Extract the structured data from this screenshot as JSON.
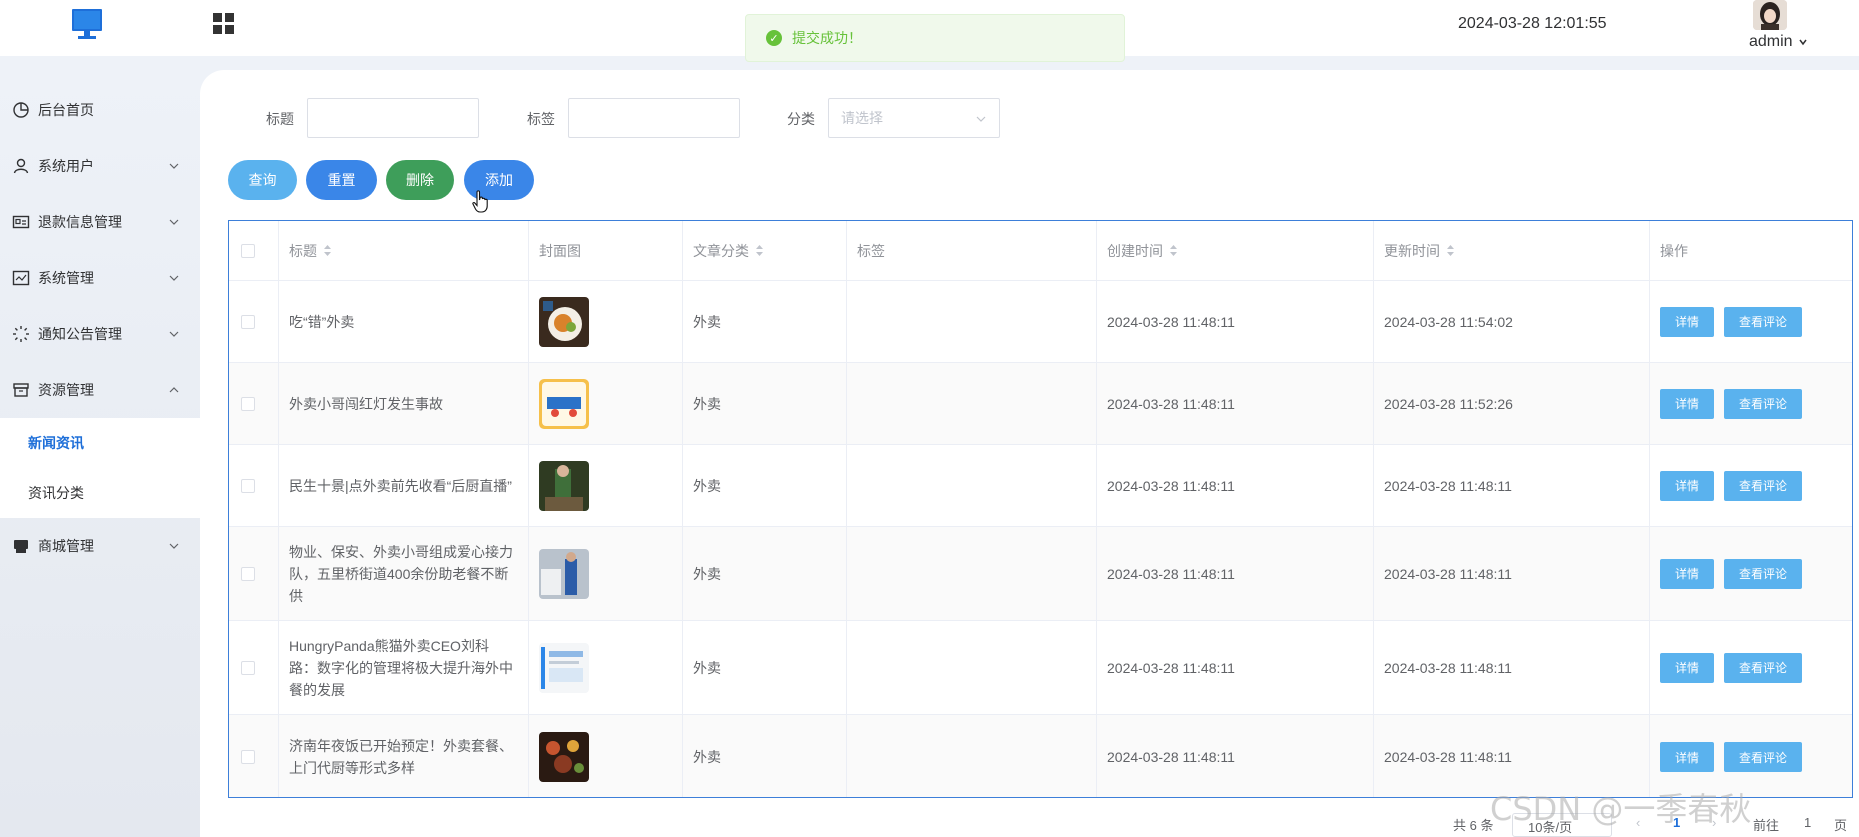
{
  "header": {
    "datetime": "2024-03-28 12:01:55",
    "username": "admin",
    "toast": "提交成功！"
  },
  "sidebar": {
    "items": [
      {
        "label": "后台首页",
        "icon": "pie-chart-icon"
      },
      {
        "label": "系统用户",
        "icon": "user-icon"
      },
      {
        "label": "退款信息管理",
        "icon": "id-card-icon"
      },
      {
        "label": "系统管理",
        "icon": "chart-box-icon"
      },
      {
        "label": "通知公告管理",
        "icon": "loading-icon"
      },
      {
        "label": "资源管理",
        "icon": "inbox-icon"
      },
      {
        "label": "商城管理",
        "icon": "printer-icon"
      }
    ],
    "subitems": [
      {
        "label": "新闻资讯",
        "active": true
      },
      {
        "label": "资讯分类",
        "active": false
      }
    ]
  },
  "filters": {
    "title_label": "标题",
    "tag_label": "标签",
    "category_label": "分类",
    "category_placeholder": "请选择",
    "title_value": "",
    "tag_value": ""
  },
  "buttons": {
    "query": "查询",
    "reset": "重置",
    "delete": "删除",
    "add": "添加"
  },
  "table": {
    "headers": {
      "title": "标题",
      "cover": "封面图",
      "category": "文章分类",
      "tags": "标签",
      "created": "创建时间",
      "updated": "更新时间",
      "actions": "操作"
    },
    "rows": [
      {
        "title": "吃“错”外卖",
        "category": "外卖",
        "tags": "",
        "created": "2024-03-28 11:48:11",
        "updated": "2024-03-28 11:54:02"
      },
      {
        "title": "外卖小哥闯红灯发生事故",
        "category": "外卖",
        "tags": "",
        "created": "2024-03-28 11:48:11",
        "updated": "2024-03-28 11:52:26"
      },
      {
        "title": "民生十景|点外卖前先收看“后厨直播”",
        "category": "外卖",
        "tags": "",
        "created": "2024-03-28 11:48:11",
        "updated": "2024-03-28 11:48:11"
      },
      {
        "title": "物业、保安、外卖小哥组成爱心接力队，五里桥街道400余份助老餐不断供",
        "category": "外卖",
        "tags": "",
        "created": "2024-03-28 11:48:11",
        "updated": "2024-03-28 11:48:11"
      },
      {
        "title": "HungryPanda熊猫外卖CEO刘科路：数字化的管理将极大提升海外中餐的发展",
        "category": "外卖",
        "tags": "",
        "created": "2024-03-28 11:48:11",
        "updated": "2024-03-28 11:48:11"
      },
      {
        "title": "济南年夜饭已开始预定！外卖套餐、上门代厨等形式多样",
        "category": "外卖",
        "tags": "",
        "created": "2024-03-28 11:48:11",
        "updated": "2024-03-28 11:48:11"
      }
    ],
    "detail_label": "详情",
    "comment_label": "查看评论"
  },
  "pagination": {
    "total": "共 6 条",
    "page_size": "10条/页",
    "current": "1",
    "goto_label": "前往",
    "goto_value": "1",
    "page_suffix": "页"
  },
  "watermark": "CSDN @一季春秋",
  "colors": {
    "query": "#5ab2ee",
    "reset": "#3a86e8",
    "delete": "#3e9e5a",
    "add": "#3a86e8",
    "accent": "#1e6fd9"
  }
}
